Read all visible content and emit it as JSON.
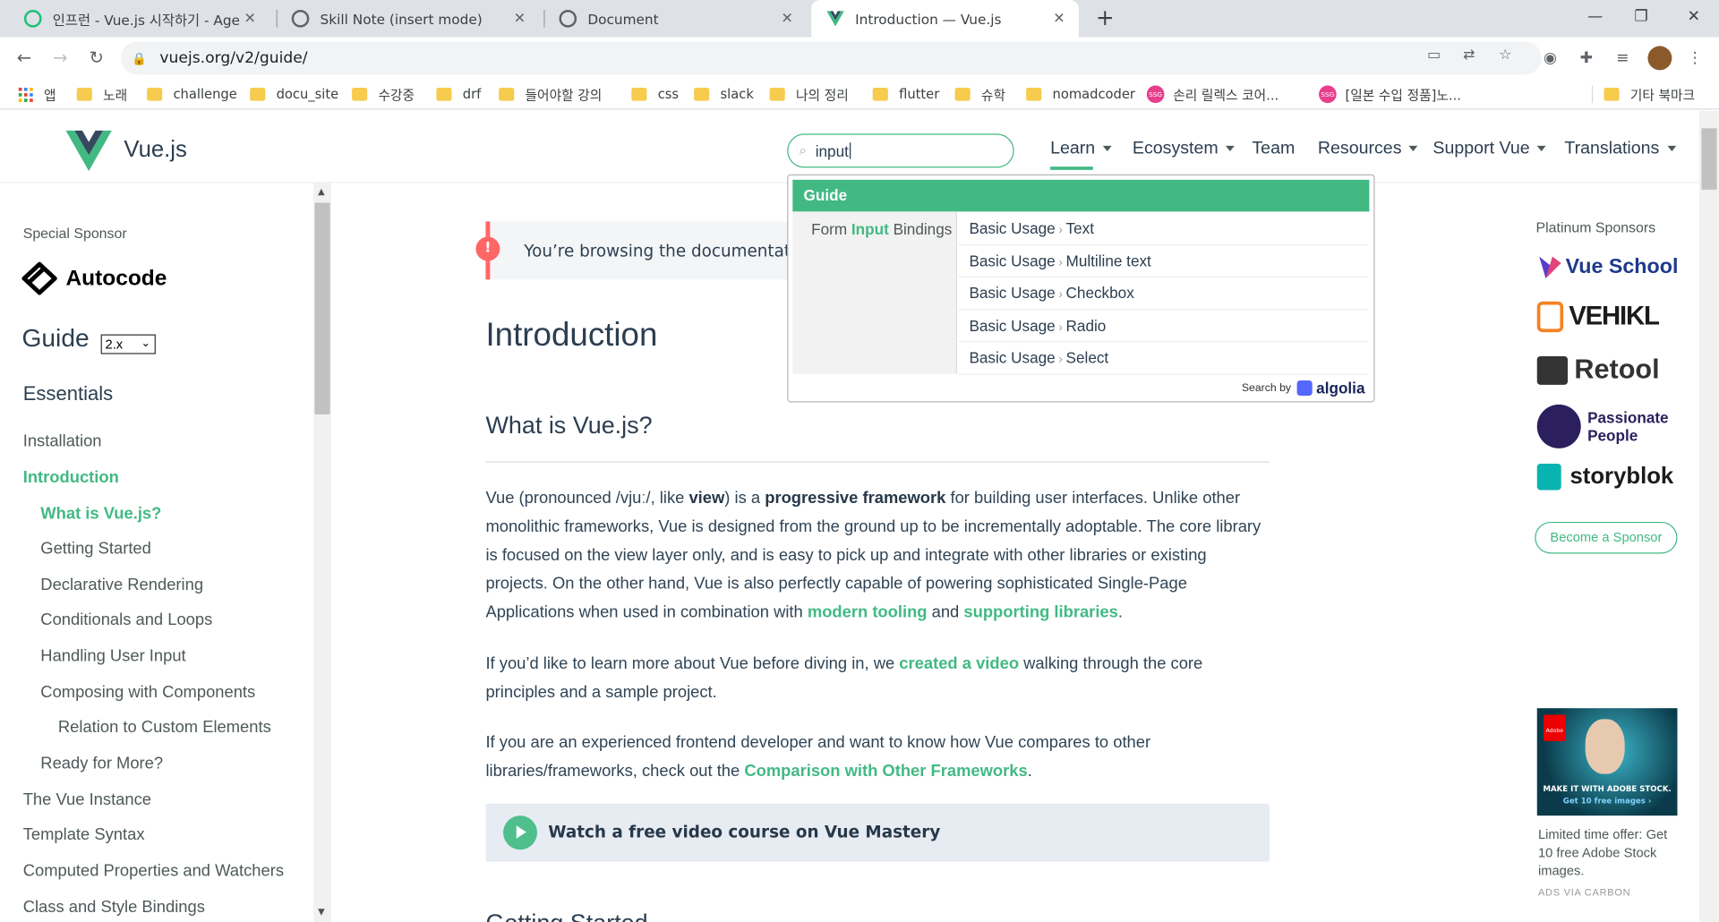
{
  "browser": {
    "tabs": [
      {
        "title": "인프런 - Vue.js 시작하기 - Age",
        "favicon_color": "#1dc078"
      },
      {
        "title": "Skill Note (insert mode)",
        "favicon_color": "#5f6368"
      },
      {
        "title": "Document",
        "favicon_color": "#5f6368"
      },
      {
        "title": "Introduction — Vue.js",
        "favicon_color": "#42b983"
      }
    ],
    "url": "vuejs.org/v2/guide/",
    "bookmarks": [
      {
        "label": "앱",
        "icon": "apps-icon"
      },
      {
        "label": "노래",
        "icon": "folder-icon"
      },
      {
        "label": "challenge",
        "icon": "folder-icon"
      },
      {
        "label": "docu_site",
        "icon": "folder-icon"
      },
      {
        "label": "수강중",
        "icon": "folder-icon"
      },
      {
        "label": "drf",
        "icon": "folder-icon"
      },
      {
        "label": "들어야할 강의",
        "icon": "folder-icon"
      },
      {
        "label": "css",
        "icon": "folder-icon"
      },
      {
        "label": "slack",
        "icon": "folder-icon"
      },
      {
        "label": "나의 정리",
        "icon": "folder-icon"
      },
      {
        "label": "flutter",
        "icon": "folder-icon"
      },
      {
        "label": "슈학",
        "icon": "folder-icon"
      },
      {
        "label": "nomadcoder",
        "icon": "folder-icon"
      },
      {
        "label": "손리 릴렉스 코어...",
        "icon": "ssg-icon"
      },
      {
        "label": "[일본 수입 정품]노...",
        "icon": "ssg-icon"
      },
      {
        "label": "기타 북마크",
        "icon": "folder-icon"
      }
    ]
  },
  "header": {
    "logo_text": "Vue.js",
    "search_value": "input",
    "nav": [
      {
        "label": "Learn",
        "dropdown": true
      },
      {
        "label": "Ecosystem",
        "dropdown": true
      },
      {
        "label": "Team",
        "dropdown": false
      },
      {
        "label": "Resources",
        "dropdown": true
      },
      {
        "label": "Support Vue",
        "dropdown": true
      },
      {
        "label": "Translations",
        "dropdown": true
      }
    ]
  },
  "search_dropdown": {
    "section": "Guide",
    "category_prefix": "Form ",
    "category_match": "Input",
    "category_suffix": " Bindings",
    "results": [
      {
        "parent": "Basic Usage",
        "child": "Text"
      },
      {
        "parent": "Basic Usage",
        "child": "Multiline text"
      },
      {
        "parent": "Basic Usage",
        "child": "Checkbox"
      },
      {
        "parent": "Basic Usage",
        "child": "Radio"
      },
      {
        "parent": "Basic Usage",
        "child": "Select"
      }
    ],
    "search_by": "Search by",
    "provider": "algolia"
  },
  "sidebar": {
    "special_sponsor_label": "Special Sponsor",
    "special_sponsor": "Autocode",
    "guide_title": "Guide",
    "version": "2.x",
    "section": "Essentials",
    "items": [
      {
        "label": "Installation",
        "level": 0,
        "active": false
      },
      {
        "label": "Introduction",
        "level": 0,
        "active": true
      },
      {
        "label": "What is Vue.js?",
        "level": 1,
        "active": true
      },
      {
        "label": "Getting Started",
        "level": 1,
        "active": false
      },
      {
        "label": "Declarative Rendering",
        "level": 1,
        "active": false
      },
      {
        "label": "Conditionals and Loops",
        "level": 1,
        "active": false
      },
      {
        "label": "Handling User Input",
        "level": 1,
        "active": false
      },
      {
        "label": "Composing with Components",
        "level": 1,
        "active": false
      },
      {
        "label": "Relation to Custom Elements",
        "level": 2,
        "active": false
      },
      {
        "label": "Ready for More?",
        "level": 1,
        "active": false
      },
      {
        "label": "The Vue Instance",
        "level": 0,
        "active": false
      },
      {
        "label": "Template Syntax",
        "level": 0,
        "active": false
      },
      {
        "label": "Computed Properties and Watchers",
        "level": 0,
        "active": false
      },
      {
        "label": "Class and Style Bindings",
        "level": 0,
        "active": false
      }
    ]
  },
  "content": {
    "notice": "You’re browsing the documentation",
    "title": "Introduction",
    "section_title": "What is Vue.js?",
    "p1": {
      "a": "Vue (pronounced /vjuː/, like ",
      "b": "view",
      "c": ") is a ",
      "d": "progressive framework",
      "e": " for building user interfaces. Unlike other monolithic frameworks, Vue is designed from the ground up to be incrementally adoptable. The core library is focused on the view layer only, and is easy to pick up and integrate with other libraries or existing projects. On the other hand, Vue is also perfectly capable of powering sophisticated Single-Page Applications when used in combination with ",
      "f": "modern tooling",
      "g": " and ",
      "h": "supporting libraries",
      "i": "."
    },
    "p2": {
      "a": "If you’d like to learn more about Vue before diving in, we ",
      "b": "created a video",
      "c": " walking through the core principles and a sample project."
    },
    "p3": {
      "a": "If you are an experienced frontend developer and want to know how Vue compares to other libraries/frameworks, check out the ",
      "b": "Comparison with Other Frameworks",
      "c": "."
    },
    "video_course": "Watch a free video course on Vue Mastery",
    "next_heading": "Getting Started"
  },
  "right_sidebar": {
    "platinum_label": "Platinum Sponsors",
    "sponsors": [
      "Vue School",
      "VEHIKL",
      "Retool",
      "Passionate People",
      "storyblok"
    ],
    "become_sponsor": "Become a Sponsor",
    "ad_line1": "MAKE IT WITH ADOBE STOCK.",
    "ad_line2": "Get 10 free images ›",
    "ad_brand": "Adobe",
    "ad_text": "Limited time offer: Get 10 free Adobe Stock images.",
    "ads_via": "ADS VIA CARBON"
  },
  "colors": {
    "accent": "#42b983",
    "text": "#2c3e50",
    "warning": "#f66"
  }
}
